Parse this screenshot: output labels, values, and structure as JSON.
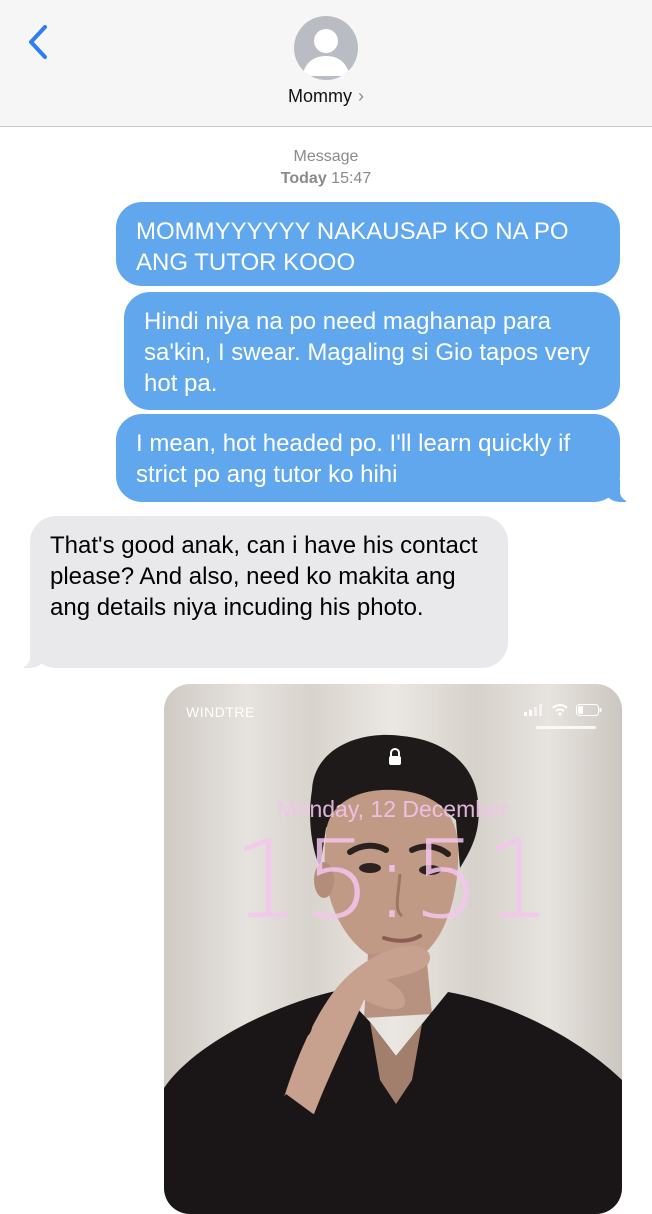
{
  "header": {
    "contact_name": "Mommy",
    "chevron": "›",
    "back_icon": "back-chevron-icon",
    "avatar_icon": "person-silhouette-icon"
  },
  "conversation": {
    "service_label": "Message",
    "day_label": "Today",
    "time_label": "15:47"
  },
  "messages": [
    {
      "direction": "sent",
      "text": "MOMMYYYYYY NAKAUSAP KO NA PO ANG TUTOR KOOO"
    },
    {
      "direction": "sent",
      "text": "Hindi niya na po need maghanap para sa'kin, I swear. Magaling si Gio tapos very hot pa."
    },
    {
      "direction": "sent",
      "text": "I mean, hot headed po. I'll learn quickly if strict po ang tutor ko hihi"
    },
    {
      "direction": "received",
      "text": "That's good anak, can i have his contact please? And also, need ko makita ang ang details niya incuding his photo."
    }
  ],
  "attachment": {
    "type": "screenshot-photo",
    "carrier": "WINDTRE",
    "date_text": "Monday, 12 December",
    "time_text": "15:51"
  },
  "colors": {
    "sent_bubble": "#60a7ee",
    "received_bubble": "#e9e9ec",
    "accent": "#2f7df6",
    "lockscreen_text": "#f5c6ef"
  }
}
